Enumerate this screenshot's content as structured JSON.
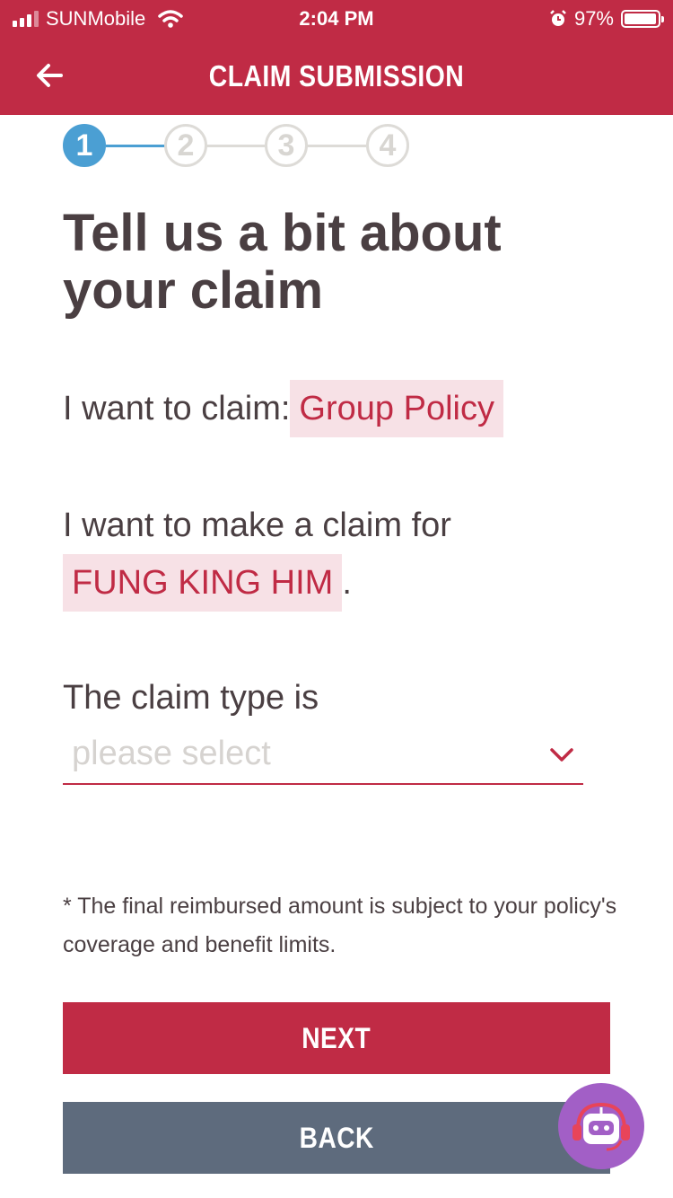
{
  "status_bar": {
    "carrier": "SUNMobile",
    "time": "2:04 PM",
    "battery": "97%",
    "battery_level": 0.97
  },
  "header": {
    "title": "CLAIM SUBMISSION",
    "back_icon": "arrow-left-icon"
  },
  "stepper": {
    "steps": [
      "1",
      "2",
      "3",
      "4"
    ],
    "current_step": 1
  },
  "main": {
    "heading": "Tell us a bit about your claim",
    "claim_prefix": "I want to claim:",
    "claim_value": "Group Policy",
    "claimant_prefix": "I want to make a claim for",
    "claimant_value": "FUNG KING HIM",
    "claimant_suffix": ".",
    "claim_type_label": "The claim type is",
    "claim_type_placeholder": "please select",
    "note": "* The final reimbursed amount is subject to your policy's coverage and benefit limits."
  },
  "buttons": {
    "next": "NEXT",
    "back": "BACK"
  },
  "chatbot": {
    "icon": "robot-headset-icon"
  },
  "colors": {
    "brand": "#c02b45",
    "step_active": "#4b9fd3",
    "back_button": "#5e6b7d",
    "chip_bg": "#f7e1e6",
    "chatbot": "#a25fc6"
  }
}
